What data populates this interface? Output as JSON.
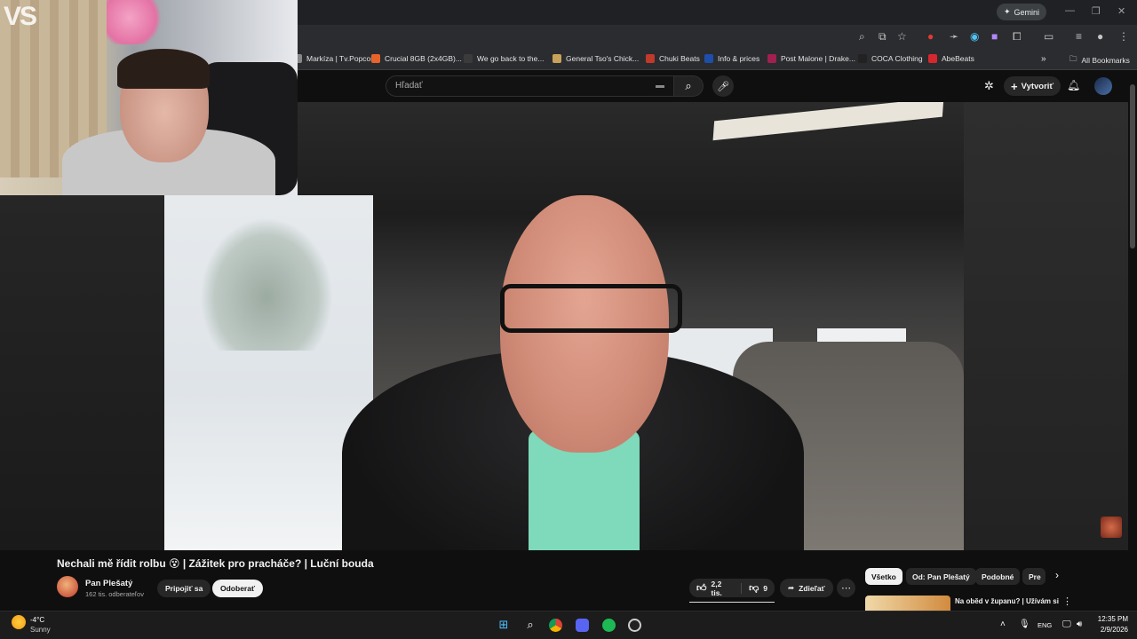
{
  "browser": {
    "gemini_label": "Gemini",
    "bookmarks": [
      {
        "label": "Markíza | Tv.Popcor...",
        "color": "#888888"
      },
      {
        "label": "Crucial 8GB (2x4GB)...",
        "color": "#e8632b"
      },
      {
        "label": "We go back to the...",
        "color": "#3b3b3b"
      },
      {
        "label": "General Tso's Chick...",
        "color": "#c8a25a"
      },
      {
        "label": "Chuki Beats",
        "color": "#c0392b"
      },
      {
        "label": "Info & prices",
        "color": "#1e4ea8"
      },
      {
        "label": "Post Malone | Drake...",
        "color": "#a31f4f"
      },
      {
        "label": "COCA Clothing",
        "color": "#222222"
      },
      {
        "label": "AbeBeats",
        "color": "#d6262e"
      }
    ],
    "all_bookmarks_label": "All Bookmarks"
  },
  "youtube": {
    "search_placeholder": "Hľadať",
    "create_label": "Vytvoriť"
  },
  "video": {
    "title": "Nechali mě řídit rolbu 😵 | Zážitek pro pracháče? | Luční bouda",
    "channel_name": "Pan Plešatý",
    "channel_subs": "162 tis. odberateľov",
    "join_label": "Pripojiť sa",
    "subscribe_label": "Odoberať",
    "likes": "2,2 tis.",
    "dislikes": "9",
    "share_label": "Zdieľať"
  },
  "chips": [
    "Všetko",
    "Od: Pan Plešatý",
    "Podobné",
    "Pre"
  ],
  "recommendation": {
    "title": "Na obĕd v županu? | Užívám si"
  },
  "webcam": {
    "logo_text": "VS"
  },
  "taskbar": {
    "temperature": "-4°C",
    "weather": "Sunny",
    "language": "ENG",
    "time": "12:35 PM",
    "date": "2/9/2026"
  }
}
